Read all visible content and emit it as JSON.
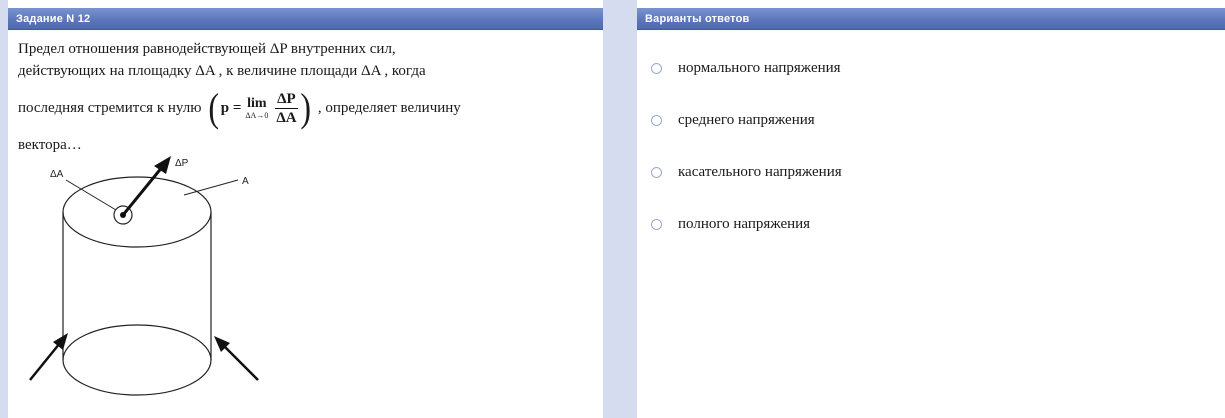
{
  "question_panel": {
    "header": "Задание N 12",
    "text_line1": "Предел отношения равнодействующей ΔP внутренних сил,",
    "text_line2": "действующих на площадку ΔA , к величине площади ΔA , когда",
    "text_line3_before": "последняя стремится к нулю",
    "text_line3_after": ", определяет величину",
    "text_line4": "вектора…",
    "formula": {
      "lhs": "p =",
      "lim": "lim",
      "lim_sub": "ΔA→0",
      "numerator": "ΔP",
      "denominator": "ΔA"
    },
    "figure_labels": {
      "delta_a": "ΔA",
      "delta_p": "ΔP",
      "a": "A"
    }
  },
  "answers_panel": {
    "header": "Варианты ответов",
    "options": [
      "нормального напряжения",
      "среднего напряжения",
      "касательного напряжения",
      "полного напряжения"
    ]
  }
}
